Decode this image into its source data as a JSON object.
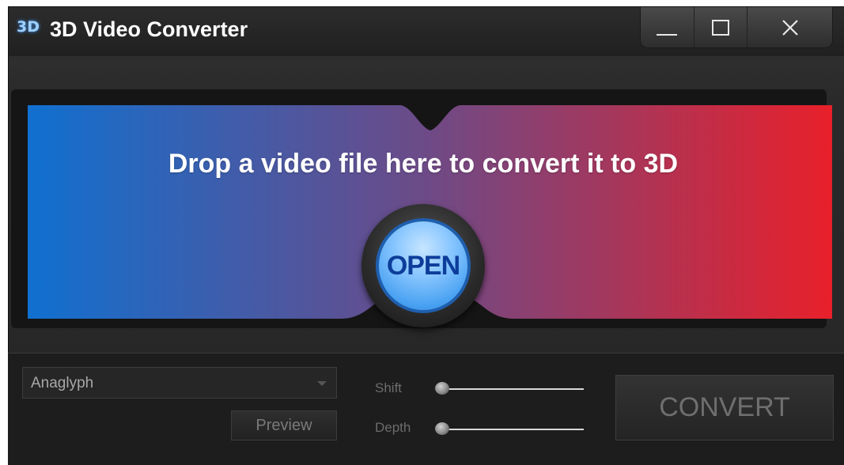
{
  "window": {
    "logo_text": "3D",
    "title": "3D Video Converter",
    "controls": [
      {
        "name": "minimize-button",
        "icon": "minimize-icon"
      },
      {
        "name": "maximize-button",
        "icon": "maximize-icon"
      },
      {
        "name": "close-button",
        "icon": "close-icon"
      }
    ]
  },
  "drop_zone": {
    "message": "Drop a video file here to convert it to 3D",
    "open_label": "OPEN",
    "gradient_colors": [
      "#1070d0",
      "#6e4a86",
      "#e8202a"
    ]
  },
  "controls": {
    "mode_value": "Anaglyph",
    "preview_label": "Preview",
    "shift_label": "Shift",
    "depth_label": "Depth",
    "shift_value": 0,
    "depth_value": 0,
    "convert_label": "CONVERT"
  }
}
